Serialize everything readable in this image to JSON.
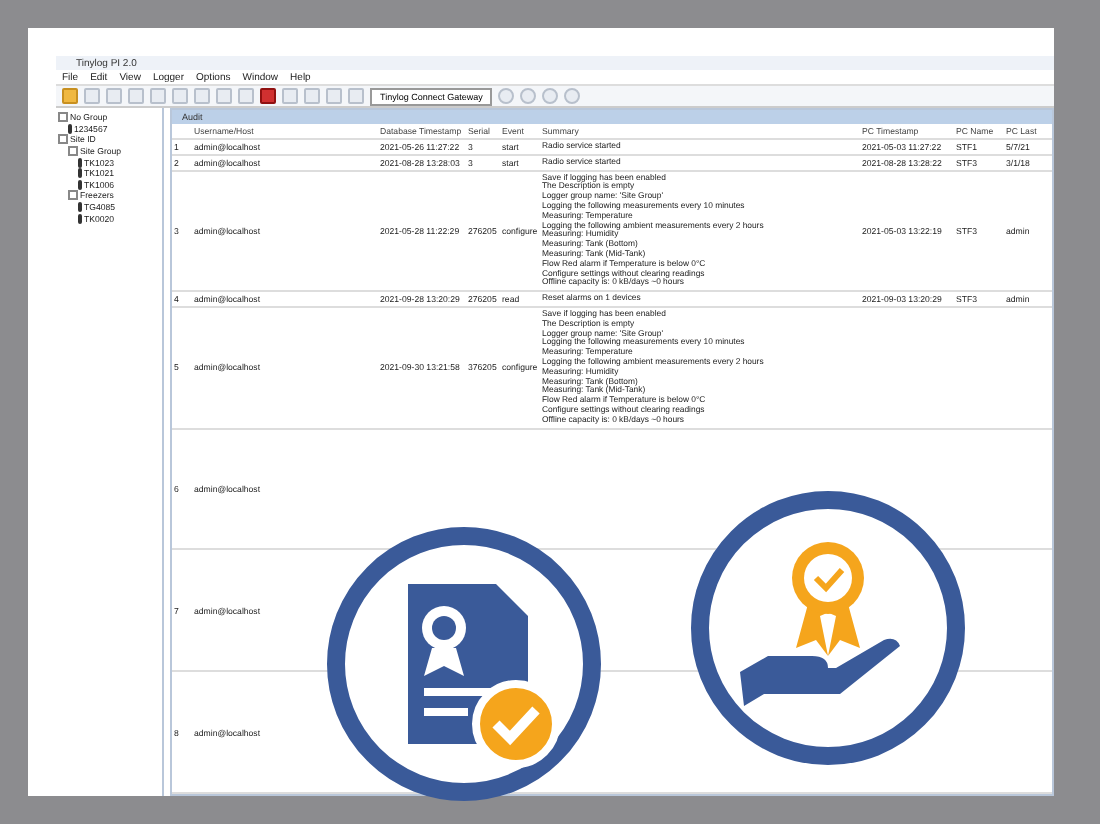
{
  "window": {
    "title": "Tinylog PI 2.0"
  },
  "menu": [
    "File",
    "Edit",
    "View",
    "Logger",
    "Options",
    "Window",
    "Help"
  ],
  "toolbar": {
    "gateway": "Tinylog Connect Gateway"
  },
  "tree": [
    {
      "label": "No Group",
      "children": [
        {
          "label": "1234567"
        }
      ]
    },
    {
      "label": "Site ID",
      "children": [
        {
          "label": "Site Group",
          "children": [
            {
              "label": "TK1023"
            },
            {
              "label": "TK1021"
            },
            {
              "label": "TK1006"
            }
          ]
        },
        {
          "label": "Freezers",
          "children": [
            {
              "label": "TG4085"
            },
            {
              "label": "TK0020"
            }
          ]
        }
      ]
    }
  ],
  "table": {
    "title": "Audit",
    "columns": [
      "",
      "Username/Host",
      "Database Timestamp",
      "Serial",
      "Event",
      "Summary",
      "PC Timestamp",
      "PC Name",
      "PC Last"
    ],
    "rows": [
      {
        "cells": [
          "1",
          "admin@localhost",
          "2021-05-26 11:27:22",
          "3",
          "start",
          "",
          "2021-05-03 11:27:22",
          "STF1",
          "5/7/21"
        ],
        "summary": [
          "Radio service started"
        ]
      },
      {
        "cells": [
          "2",
          "admin@localhost",
          "2021-08-28 13:28:03",
          "3",
          "start",
          "",
          "2021-08-28 13:28:22",
          "STF3",
          "3/1/18"
        ],
        "summary": [
          "Radio service started"
        ]
      },
      {
        "cells": [
          "3",
          "admin@localhost",
          "2021-05-28 11:22:29",
          "276205",
          "configure",
          "",
          "2021-05-03 13:22:19",
          "STF3",
          "admin"
        ],
        "summary": [
          "Save if logging has been enabled",
          "The Description is empty",
          "Logger group name: 'Site Group'",
          "Logging the following measurements every 10 minutes",
          "Measuring: Temperature",
          "Logging the following ambient measurements every 2 hours",
          "Measuring: Humidity",
          "Measuring: Tank (Bottom)",
          "Measuring: Tank (Mid-Tank)",
          "Flow Red alarm if Temperature is below 0°C",
          "Configure settings without clearing readings",
          "Offline capacity is: 0 kB/days ~0 hours"
        ]
      },
      {
        "cells": [
          "4",
          "admin@localhost",
          "2021-09-28 13:20:29",
          "276205",
          "read",
          "",
          "2021-09-03 13:20:29",
          "STF3",
          "admin"
        ],
        "summary": [
          "Reset alarms on 1 devices"
        ]
      },
      {
        "cells": [
          "5",
          "admin@localhost",
          "2021-09-30 13:21:58",
          "376205",
          "configure",
          "",
          "",
          "",
          ""
        ],
        "summary": [
          "Save if logging has been enabled",
          "The Description is empty",
          "Logger group name: 'Site Group'",
          "Logging the following measurements every 10 minutes",
          "Measuring: Temperature",
          "Logging the following ambient measurements every 2 hours",
          "Measuring: Humidity",
          "Measuring: Tank (Bottom)",
          "Measuring: Tank (Mid-Tank)",
          "Flow Red alarm if Temperature is below 0°C",
          "Configure settings without clearing readings",
          "Offline capacity is: 0 kB/days ~0 hours"
        ]
      },
      {
        "cells": [
          "6",
          "admin@localhost",
          "",
          "",
          "",
          "",
          "",
          "",
          ""
        ],
        "summary": []
      },
      {
        "cells": [
          "7",
          "admin@localhost",
          "",
          "",
          "",
          "",
          "",
          "",
          ""
        ],
        "summary": []
      },
      {
        "cells": [
          "8",
          "admin@localhost",
          "",
          "",
          "",
          "",
          "",
          "",
          ""
        ],
        "summary": []
      }
    ]
  }
}
